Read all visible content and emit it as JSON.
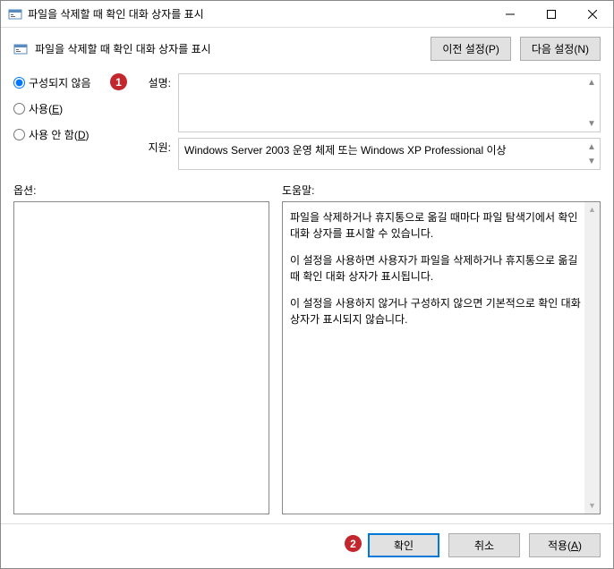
{
  "titlebar": {
    "title": "파일을 삭제할 때 확인 대화 상자를 표시"
  },
  "header": {
    "title": "파일을 삭제할 때 확인 대화 상자를 표시",
    "prev_button": "이전 설정(P)",
    "next_button": "다음 설정(N)"
  },
  "radio": {
    "not_configured": "구성되지 않음",
    "enabled_pre": "사용(",
    "enabled_u": "E",
    "enabled_post": ")",
    "disabled_pre": "사용 안 함(",
    "disabled_u": "D",
    "disabled_post": ")"
  },
  "labels": {
    "description": "설명:",
    "supported": "지원:",
    "options": "옵션:",
    "help": "도움말:"
  },
  "support": {
    "text": "Windows Server 2003 운영 체제 또는 Windows XP Professional 이상"
  },
  "help": {
    "p1": "파일을 삭제하거나 휴지통으로 옮길 때마다 파일 탐색기에서 확인 대화 상자를 표시할 수 있습니다.",
    "p2": "이 설정을 사용하면 사용자가 파일을 삭제하거나 휴지통으로 옮길 때 확인 대화 상자가 표시됩니다.",
    "p3": "이 설정을 사용하지 않거나 구성하지 않으면 기본적으로 확인 대화 상자가 표시되지 않습니다."
  },
  "footer": {
    "ok": "확인",
    "cancel": "취소",
    "apply_pre": "적용(",
    "apply_u": "A",
    "apply_post": ")"
  },
  "callouts": {
    "one": "1",
    "two": "2"
  }
}
